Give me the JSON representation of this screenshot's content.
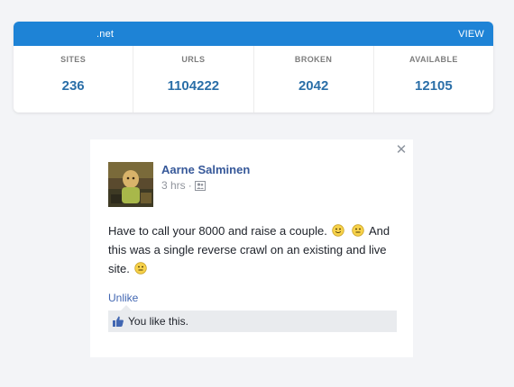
{
  "stats": {
    "header": {
      "domain_text": ".net",
      "view_label": "VIEW"
    },
    "cells": [
      {
        "label": "SITES",
        "value": "236"
      },
      {
        "label": "URLS",
        "value": "1104222"
      },
      {
        "label": "BROKEN",
        "value": "2042"
      },
      {
        "label": "AVAILABLE",
        "value": "12105"
      }
    ],
    "colors": {
      "header_bg": "#1e83d6",
      "value_text": "#2b6fa8"
    }
  },
  "post": {
    "close_icon": "close-icon",
    "author": "Aarne Salminen",
    "time": "3 hrs",
    "separator": "·",
    "audience_icon": "friends-icon",
    "text_part1": "Have to call your 8000 and raise a couple.",
    "text_part2": "And this was a single reverse crawl on an existing and live site.",
    "emojis": [
      "smile-emoji",
      "neutral-emoji",
      "neutral-emoji"
    ],
    "unlike_label": "Unlike",
    "likes_text": "You like this.",
    "colors": {
      "name": "#365899",
      "link": "#4267b2",
      "likes_bg": "#e9ebee"
    }
  }
}
